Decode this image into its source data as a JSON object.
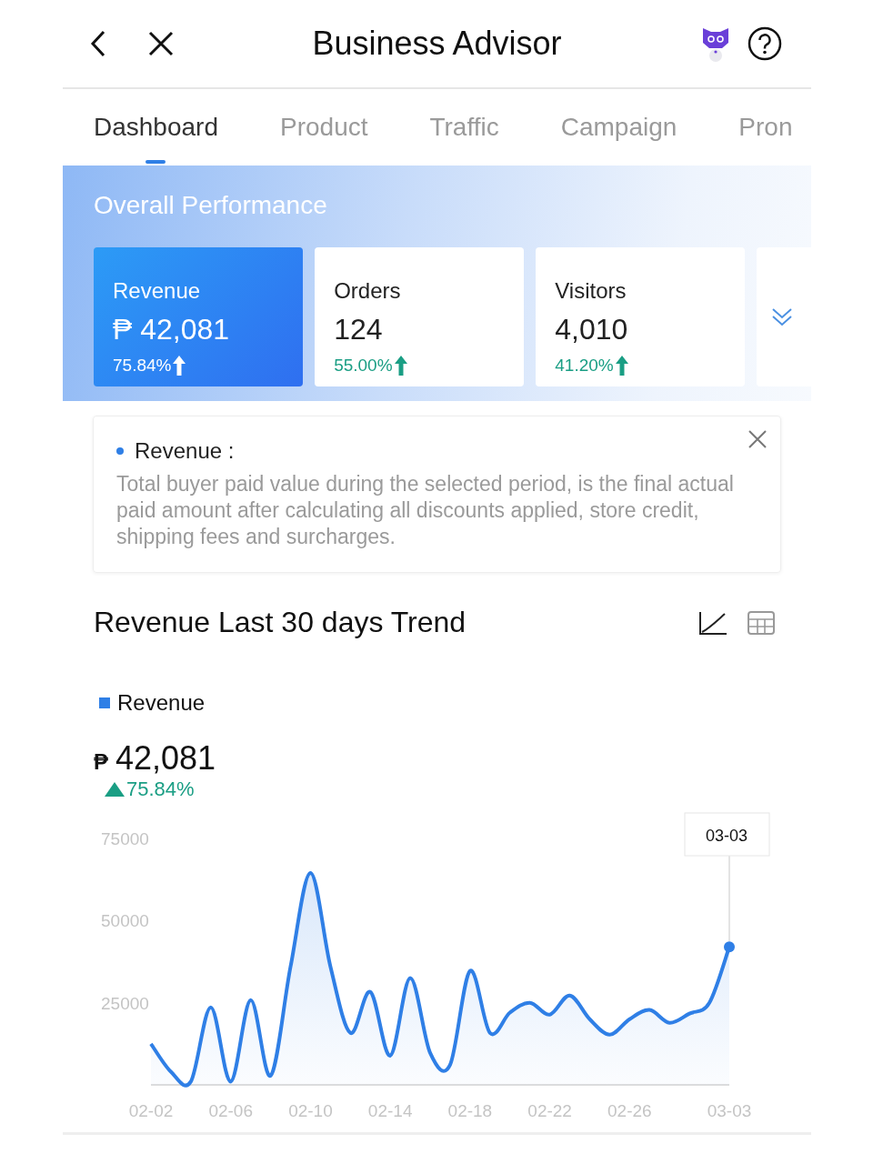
{
  "header": {
    "title": "Business Advisor"
  },
  "tabs": [
    {
      "label": "Dashboard",
      "selected": true
    },
    {
      "label": "Product",
      "selected": false
    },
    {
      "label": "Traffic",
      "selected": false
    },
    {
      "label": "Campaign",
      "selected": false
    },
    {
      "label": "Pron",
      "selected": false
    }
  ],
  "overview": {
    "title": "Overall Performance",
    "metrics": [
      {
        "label": "Revenue",
        "value": "₱ 42,081",
        "change": "75.84%",
        "selected": true
      },
      {
        "label": "Orders",
        "value": "124",
        "change": "55.00%",
        "selected": false
      },
      {
        "label": "Visitors",
        "value": "4,010",
        "change": "41.20%",
        "selected": false
      }
    ]
  },
  "info": {
    "term": "Revenue :",
    "description": "Total buyer paid value during the selected period, is the final actual paid amount after calculating all discounts applied, store credit, shipping fees and surcharges."
  },
  "trend": {
    "title": "Revenue Last 30 days Trend",
    "currency": "₱",
    "total": "42,081",
    "change": "75.84%",
    "tooltip": "03-03",
    "chart_data": {
      "type": "area",
      "categories": [
        "02-02",
        null,
        null,
        null,
        "02-06",
        null,
        null,
        null,
        "02-10",
        null,
        null,
        null,
        "02-14",
        null,
        null,
        null,
        "02-18",
        null,
        null,
        null,
        "02-22",
        null,
        null,
        null,
        "02-26",
        null,
        null,
        null,
        null,
        "03-03"
      ],
      "series": [
        {
          "name": "Revenue",
          "color": "#2f7fe6",
          "values": [
            12500,
            4000,
            1000,
            23600,
            1000,
            25800,
            2800,
            36000,
            64500,
            36000,
            15800,
            28300,
            8900,
            32500,
            9700,
            6100,
            34700,
            15800,
            22000,
            25000,
            21400,
            27200,
            20000,
            15300,
            20000,
            22800,
            18900,
            21700,
            25000,
            42000
          ]
        }
      ],
      "ylim": [
        0,
        75000
      ],
      "yticks": [
        25000,
        50000,
        75000
      ]
    }
  }
}
